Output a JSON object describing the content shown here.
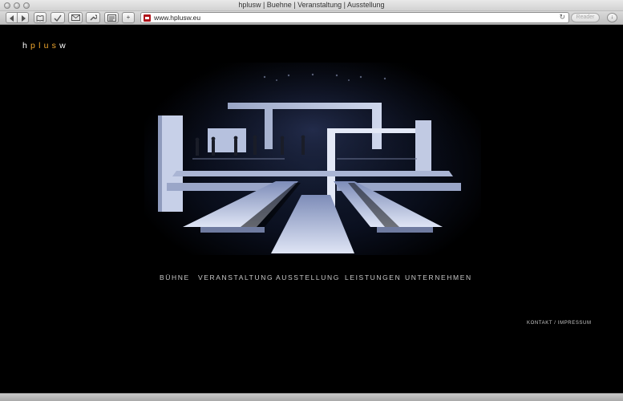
{
  "window": {
    "title": "hplusw | Buehne | Veranstaltung | Ausstellung"
  },
  "toolbar": {
    "back_icon": "back-arrow-icon",
    "forward_icon": "forward-arrow-icon",
    "show_all_bookmarks_icon": "open-book-icon",
    "history_icon": "checkmark-icon",
    "mail_icon": "envelope-icon",
    "tools_icon": "wrench-icon",
    "news_icon": "newspaper-icon",
    "new_tab_label": "+",
    "url": "www.hplusw.eu",
    "reload_icon": "reload-icon",
    "reader_label": "Reader",
    "downloads_icon": "download-arrow-icon"
  },
  "logo": {
    "h": "h",
    "plus": "plus",
    "w": "w"
  },
  "nav": {
    "items": [
      {
        "label": "BÜHNE"
      },
      {
        "label": "VERANSTALTUNG"
      },
      {
        "label": "AUSSTELLUNG"
      },
      {
        "label": "LEISTUNGEN"
      },
      {
        "label": "UNTERNEHMEN"
      }
    ]
  },
  "footer": {
    "contact": "KONTAKT",
    "separator": "/",
    "imprint": "IMPRESSUM"
  },
  "colors": {
    "background": "#000000",
    "logo_accent": "#f2a82e",
    "nav_text": "#c8c8c8"
  }
}
